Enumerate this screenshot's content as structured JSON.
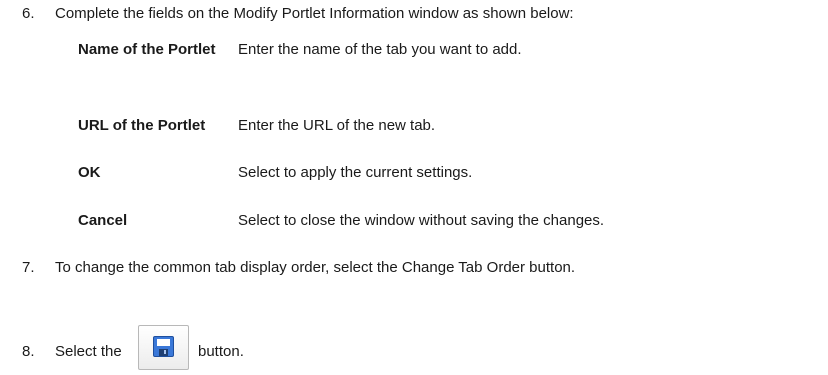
{
  "steps": [
    {
      "number": "6.",
      "text": "Complete the fields on the Modify Portlet Information window as shown below:"
    },
    {
      "number": "7.",
      "text": "To change the common tab display order, select the Change Tab Order button."
    },
    {
      "number": "8.",
      "text_before": "Select the",
      "text_after": "button."
    }
  ],
  "fields": [
    {
      "name": "Name of the Portlet",
      "description": "Enter the name of the tab you want to add."
    },
    {
      "name": "URL of the Portlet",
      "description": "Enter the URL of the new tab."
    },
    {
      "name": "OK",
      "description": "Select to apply the current settings."
    },
    {
      "name": "Cancel",
      "description": "Select to close the window without saving the changes."
    }
  ],
  "save_button": {
    "icon": "save-disk-icon",
    "color": "#3a78d8"
  }
}
